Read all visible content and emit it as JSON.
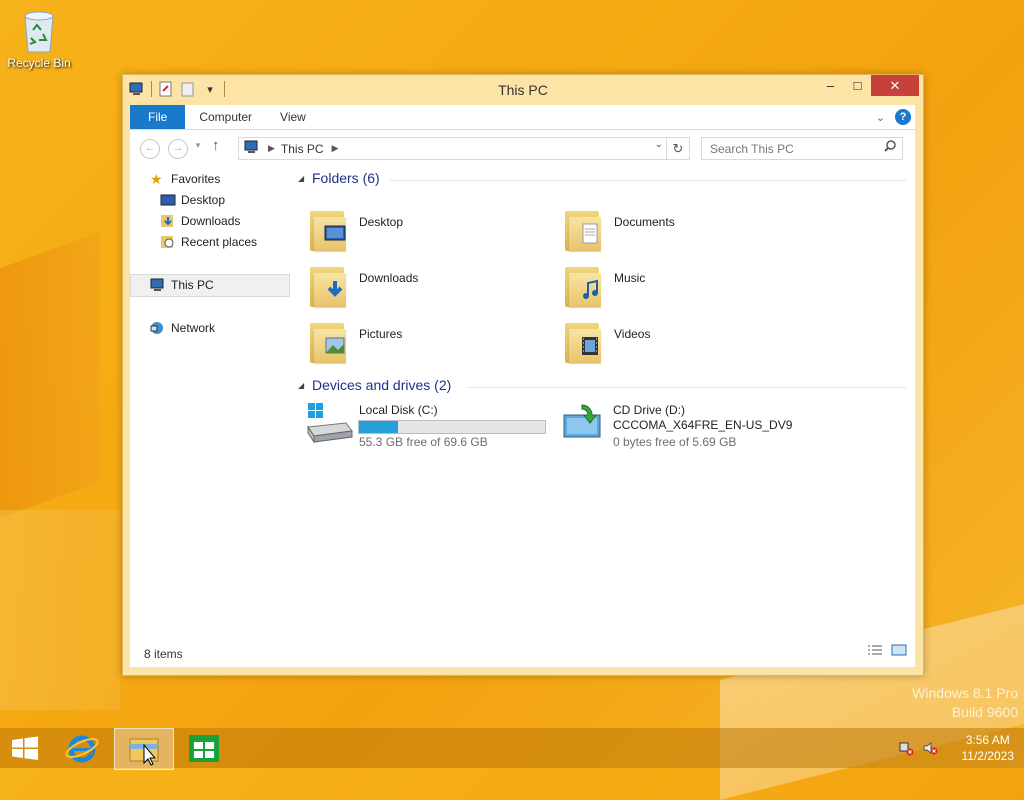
{
  "desktop": {
    "recycle_bin_label": "Recycle Bin",
    "watermark_line1": "Windows 8.1 Pro",
    "watermark_line2": "Build 9600"
  },
  "window": {
    "title": "This PC",
    "controls": {
      "minimize": "–",
      "maximize": "□",
      "close": "✕"
    }
  },
  "ribbon": {
    "tabs": [
      "File",
      "Computer",
      "View"
    ],
    "help": "?"
  },
  "address": {
    "location": "This PC",
    "search_placeholder": "Search This PC"
  },
  "nav_pane": {
    "favorites": "Favorites",
    "favorites_items": [
      "Desktop",
      "Downloads",
      "Recent places"
    ],
    "this_pc": "This PC",
    "network": "Network"
  },
  "folders_group": {
    "header": "Folders (6)",
    "items": [
      "Desktop",
      "Documents",
      "Downloads",
      "Music",
      "Pictures",
      "Videos"
    ]
  },
  "drives_group": {
    "header": "Devices and drives (2)",
    "drives": [
      {
        "name": "Local Disk (C:)",
        "detail": "55.3 GB free of 69.6 GB",
        "used_fraction": 0.21
      },
      {
        "name": "CD Drive (D:)",
        "label": "CCCOMA_X64FRE_EN-US_DV9",
        "detail": "0 bytes free of 5.69 GB"
      }
    ]
  },
  "status_bar": {
    "items_count": "8 items"
  },
  "taskbar": {
    "time": "3:56 AM",
    "date": "11/2/2023"
  },
  "colors": {
    "accent": "#1979ca",
    "close": "#c7403a",
    "group_header": "#1e3287",
    "drive_bar": "#26a0da"
  }
}
